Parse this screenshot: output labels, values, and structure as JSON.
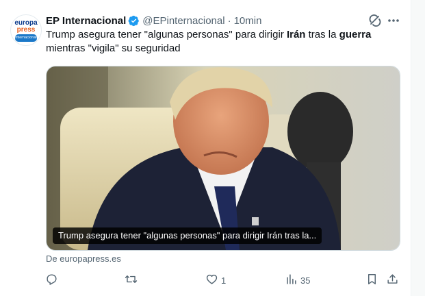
{
  "account": {
    "name": "EP Internacional",
    "handle": "@EPinternacional",
    "separator": "·",
    "time": "10min",
    "avatar_line1": "europa",
    "avatar_line2": "press",
    "avatar_band": "internacional"
  },
  "tweet": {
    "text_part1": "Trump asegura tener \"algunas personas\" para dirigir ",
    "text_bold1": "Irán",
    "text_part2": " tras la ",
    "text_bold2": "guerra",
    "text_part3": " mientras \"vigila\" su seguridad"
  },
  "media": {
    "caption": "Trump asegura tener \"algunas personas\" para dirigir Irán tras la..."
  },
  "source": "De europapress.es",
  "actions": {
    "reply_count": "",
    "retweet_count": "",
    "like_count": "1",
    "views_count": "35"
  },
  "icons": {
    "verified": "verified-badge-icon",
    "grok": "grok-icon",
    "more": "more-icon",
    "reply": "reply-icon",
    "retweet": "retweet-icon",
    "like": "like-icon",
    "views": "views-icon",
    "bookmark": "bookmark-icon",
    "share": "share-icon"
  },
  "colors": {
    "text": "#0f1419",
    "muted": "#536471",
    "verified": "#1d9bf0",
    "border": "#cfd9de"
  }
}
